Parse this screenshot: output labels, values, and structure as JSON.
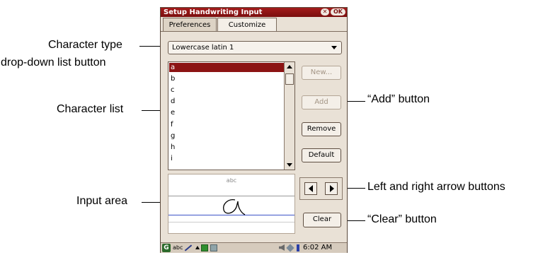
{
  "callouts": {
    "character_type_line1": "Character type",
    "character_type_line2": "drop-down list button",
    "character_list": "Character list",
    "input_area": "Input area",
    "add_button": "“Add” button",
    "arrow_buttons": "Left and right arrow buttons",
    "clear_button": "“Clear” button"
  },
  "window": {
    "title": "Setup Handwriting Input",
    "close_label": "✕",
    "ok_label": "OK"
  },
  "tabs": [
    {
      "label": "Preferences",
      "active": false
    },
    {
      "label": "Customize",
      "active": true
    }
  ],
  "dropdown": {
    "selected": "Lowercase latin 1"
  },
  "character_list": {
    "items": [
      "a",
      "b",
      "c",
      "d",
      "e",
      "f",
      "g",
      "h",
      "i"
    ],
    "selected_index": 0
  },
  "buttons": {
    "new": "New...",
    "add": "Add",
    "remove": "Remove",
    "default": "Default",
    "clear": "Clear"
  },
  "input_area": {
    "hint": "abc"
  },
  "taskbar": {
    "start_icon": "G",
    "abc_label": "abc",
    "time": "6:02 AM"
  },
  "colors": {
    "title_bar": "#8c1414",
    "selection": "#8c1414",
    "baseline": "#3d53c8",
    "window_bg": "#e9e1d6"
  }
}
